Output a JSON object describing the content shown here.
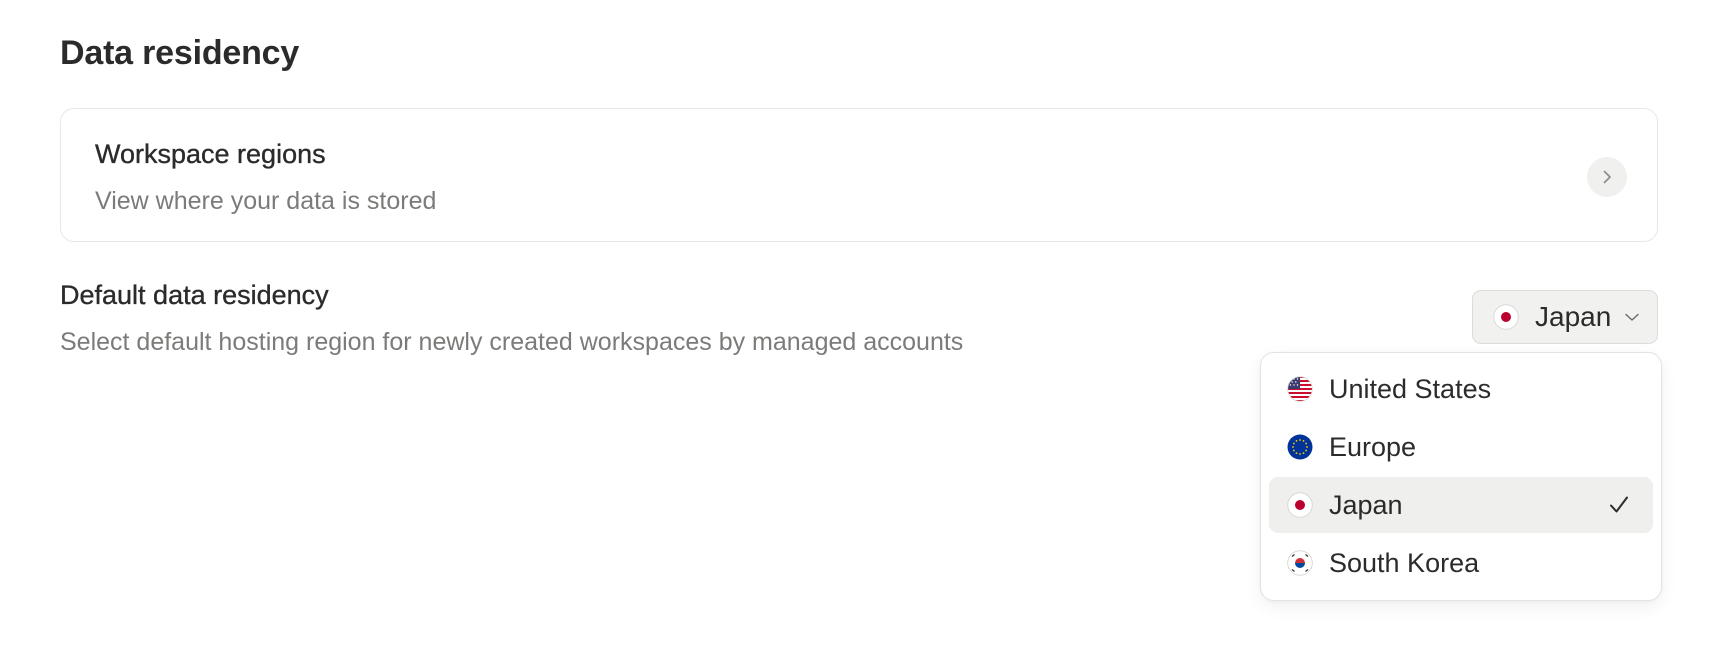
{
  "page": {
    "title": "Data residency"
  },
  "workspace_regions_card": {
    "title": "Workspace regions",
    "subtitle": "View where your data is stored",
    "icon": "chevron-right-icon"
  },
  "default_residency": {
    "title": "Default data residency",
    "subtitle": "Select default hosting region for newly created workspaces by managed accounts",
    "selected_value": "Japan",
    "selected_icon": "japan-flag-icon"
  },
  "dropdown": {
    "options": [
      {
        "label": "United States",
        "icon": "us-flag-icon",
        "selected": false
      },
      {
        "label": "Europe",
        "icon": "eu-flag-icon",
        "selected": false
      },
      {
        "label": "Japan",
        "icon": "japan-flag-icon",
        "selected": true
      },
      {
        "label": "South Korea",
        "icon": "south-korea-flag-icon",
        "selected": false
      }
    ]
  },
  "colors": {
    "text_primary": "#2b2b2b",
    "text_secondary": "#7b7b79",
    "border": "#e7e7e5",
    "selected_bg": "#efefed",
    "japan_red": "#bc002d",
    "eu_blue": "#003399"
  }
}
